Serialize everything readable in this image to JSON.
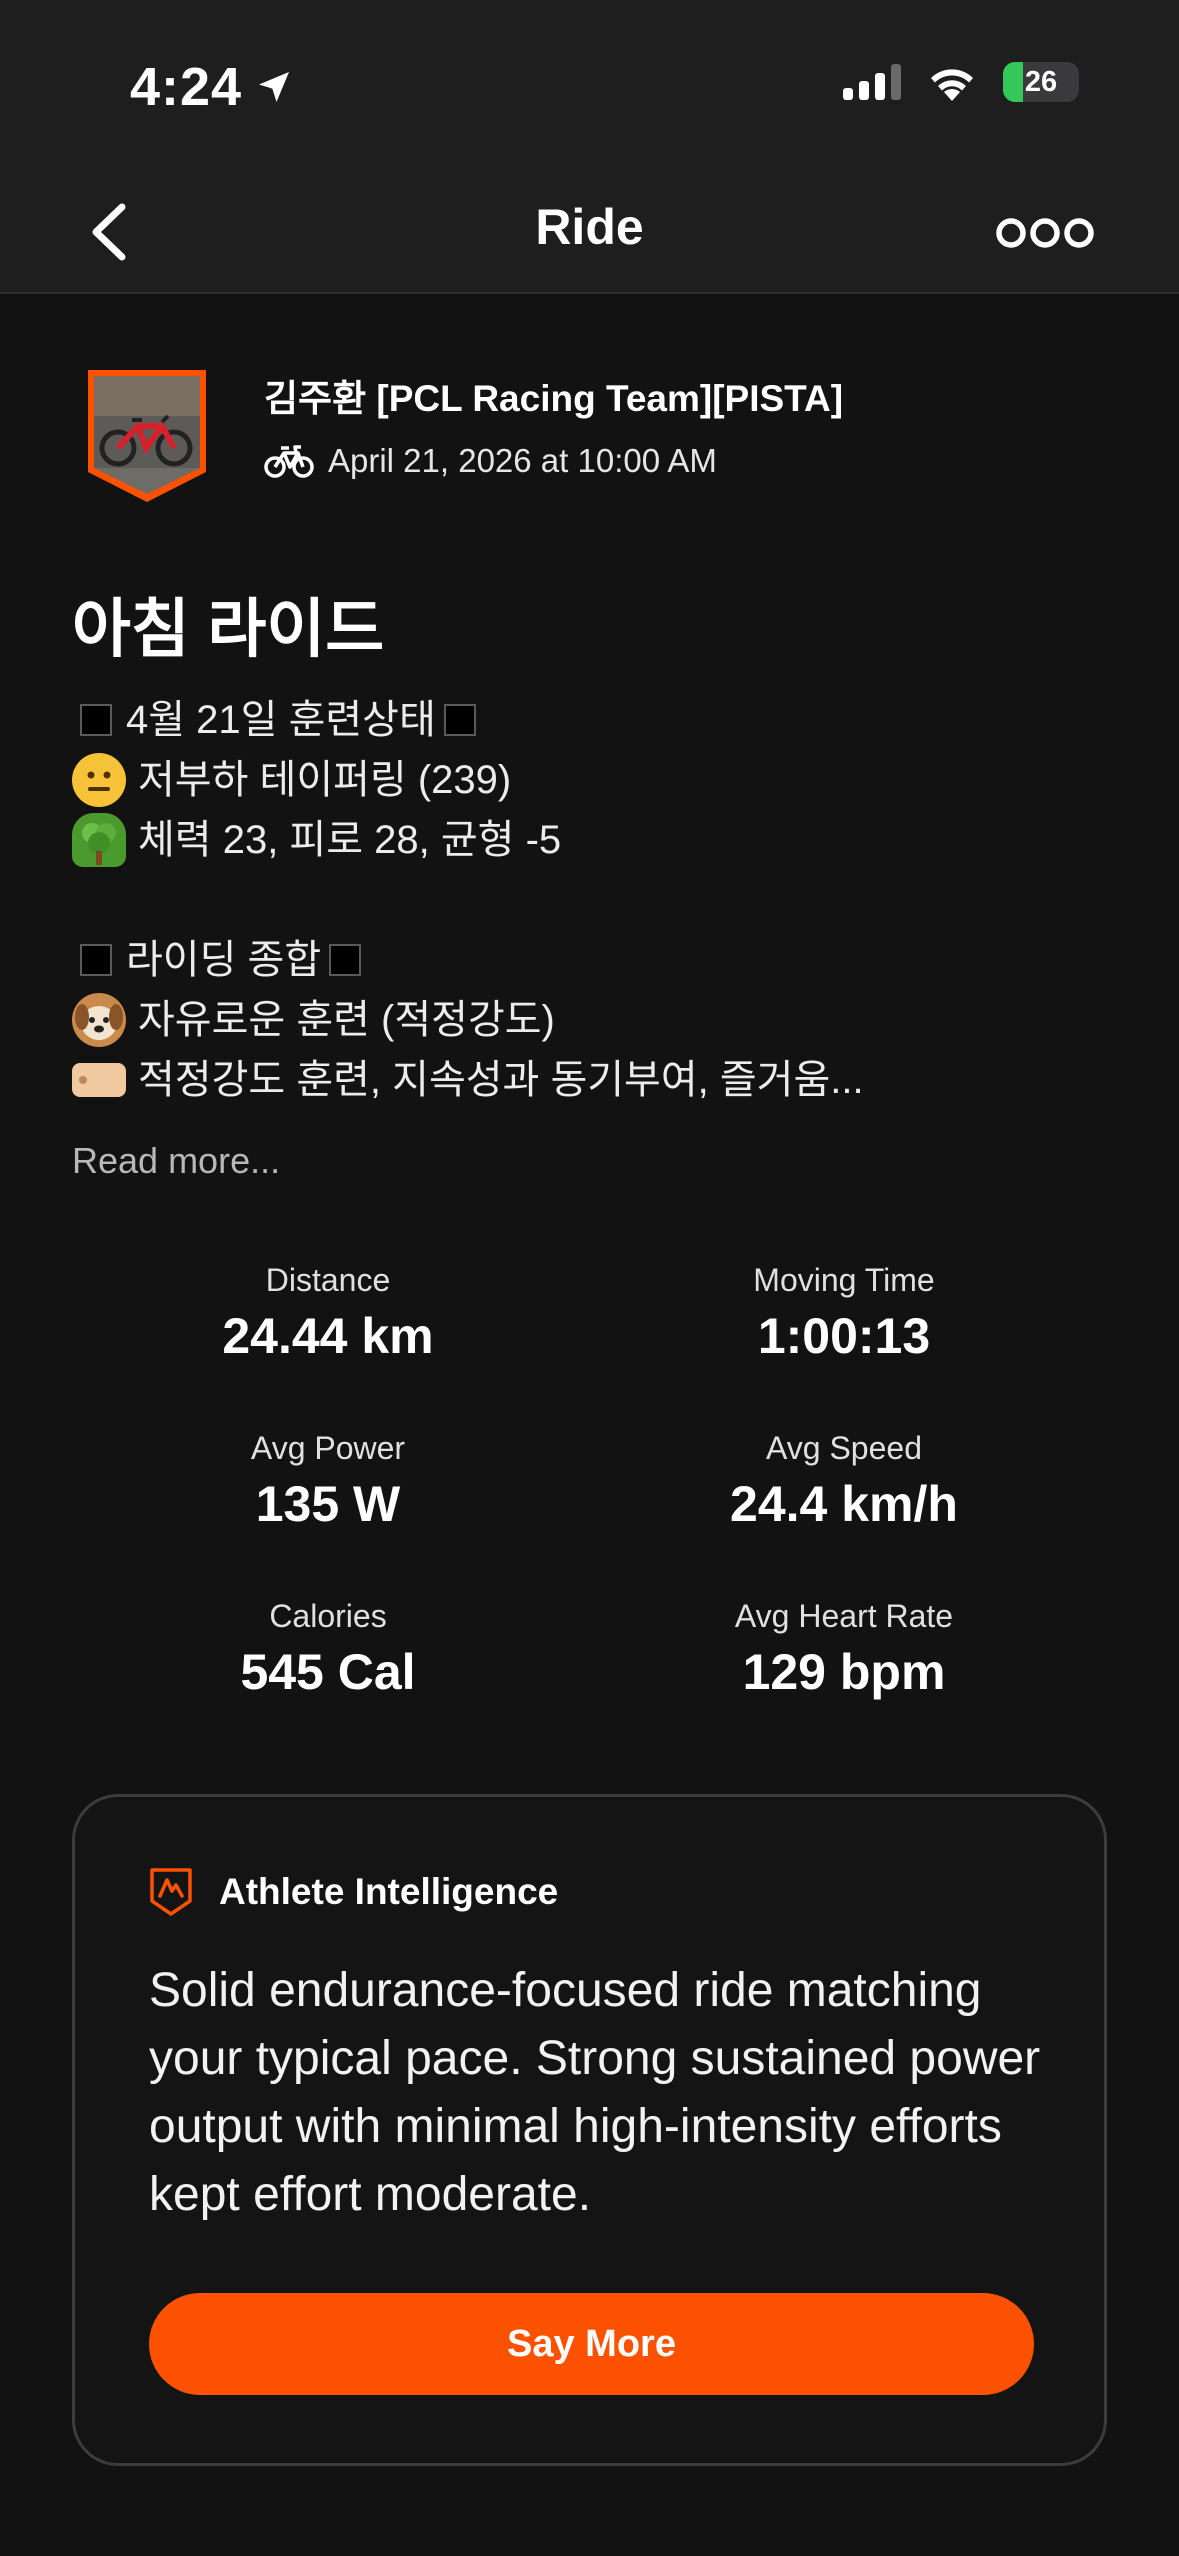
{
  "status_bar": {
    "time": "4:24",
    "battery": "26",
    "battery_level": 0.26
  },
  "nav": {
    "title": "Ride"
  },
  "athlete": {
    "name": "김주환 [PCL Racing Team][PISTA]",
    "date": "April 21, 2026 at 10:00 AM"
  },
  "activity": {
    "title": "아침 라이드",
    "description": {
      "line1": "4월 21일 훈련상태",
      "line2": "저부하 테이퍼링 (239)",
      "line3": "체력 23, 피로 28, 균형 -5",
      "line4": "라이딩 종합",
      "line5": "자유로운 훈련 (적정강도)",
      "line6": "적정강도 훈련, 지속성과 동기부여, 즐거움..."
    },
    "read_more": "Read more..."
  },
  "stats": {
    "distance": {
      "label": "Distance",
      "value": "24.44 km"
    },
    "moving_time": {
      "label": "Moving Time",
      "value": "1:00:13"
    },
    "avg_power": {
      "label": "Avg Power",
      "value": "135 W"
    },
    "avg_speed": {
      "label": "Avg Speed",
      "value": "24.4 km/h"
    },
    "calories": {
      "label": "Calories",
      "value": "545 Cal"
    },
    "avg_hr": {
      "label": "Avg Heart Rate",
      "value": "129 bpm"
    }
  },
  "athlete_intelligence": {
    "title": "Athlete Intelligence",
    "summary": "Solid endurance-focused ride matching your typical pace. Strong sustained power output with minimal high-intensity efforts kept effort moderate.",
    "button": "Say More"
  },
  "colors": {
    "accent": "#fc5200",
    "background": "#121212",
    "bar": "#1e1e1e",
    "battery": "#34c759"
  },
  "icons": [
    "location-arrow-icon",
    "signal-icon",
    "wifi-icon",
    "battery-icon",
    "back-chevron-icon",
    "more-icon",
    "bike-icon",
    "athlete-intelligence-icon"
  ]
}
